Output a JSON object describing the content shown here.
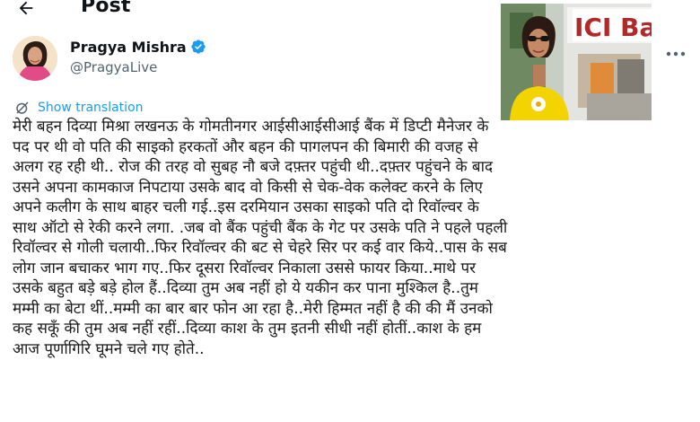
{
  "header": {
    "title": "Post",
    "back_icon": "arrow-left-icon"
  },
  "author": {
    "name": "Pragya Mishra",
    "handle": "@PragyaLive",
    "verified": true,
    "verified_color": "#1d9bf0"
  },
  "translate": {
    "label": "Show translation",
    "icon": "translate-icon",
    "color": "#1d9bf0"
  },
  "post": {
    "lines": [
      "मेरी बहन दिव्या मिश्रा लखनऊ के गोमतीनगर आईसीआईसीआई बैंक में डिप्टी मैनेजर के",
      "पद पर थी वो पति की साइको हरकतों और बहन की पागलपन की बिमारी की वजह से",
      "अलग रह रही थी.. रोज की तरह वो सुबह नौ बजे दफ़्तर पहुंची थी..दफ़्तर पहुंचने के बाद",
      "उसने अपना कामकाज निपटाया उसके बाद वो किसी  से चेक-वेक कलेक्ट करने के लिए",
      "अपने कलीग के साथ बाहर चली गई..इस दरमियान उसका साइको पति दो रिवॉल्वर के",
      "साथ ऑटो से रेकी करने लगा. .जब वो बैंक पहुंची बैंक के गेट पर उसके पति ने पहले पहली",
      "रिवॉल्वर से गोली चलायी..फिर रिवॉल्वर की बट से चेहरे सिर पर कई वार किये..पास के सब",
      "लोग जान बचाकर भाग गए..फिर दूसरा रिवॉल्वर निकाला उससे फायर किया..माथे पर",
      "उसके बहुत बड़े बड़े होल हैं..दिव्या तुम अब नहीं हो ये यकीन कर पाना मुश्किल है..तुम",
      "मम्मी का बेटा थीं..मम्मी का  बार बार फोन आ रहा है..मेरी हिम्मत नहीं है की की मैं उनको",
      "कह सकूँ की तुम अब नहीं रहीं..दिव्या काश के तुम इतनी सीधी नहीं होतीं..काश के हम",
      "आज पूर्णागिरि घूमने चले गए होते.."
    ]
  },
  "attached_photo": {
    "sign_text": "ICI Ba"
  },
  "more_icon": "more-horizontal-icon"
}
